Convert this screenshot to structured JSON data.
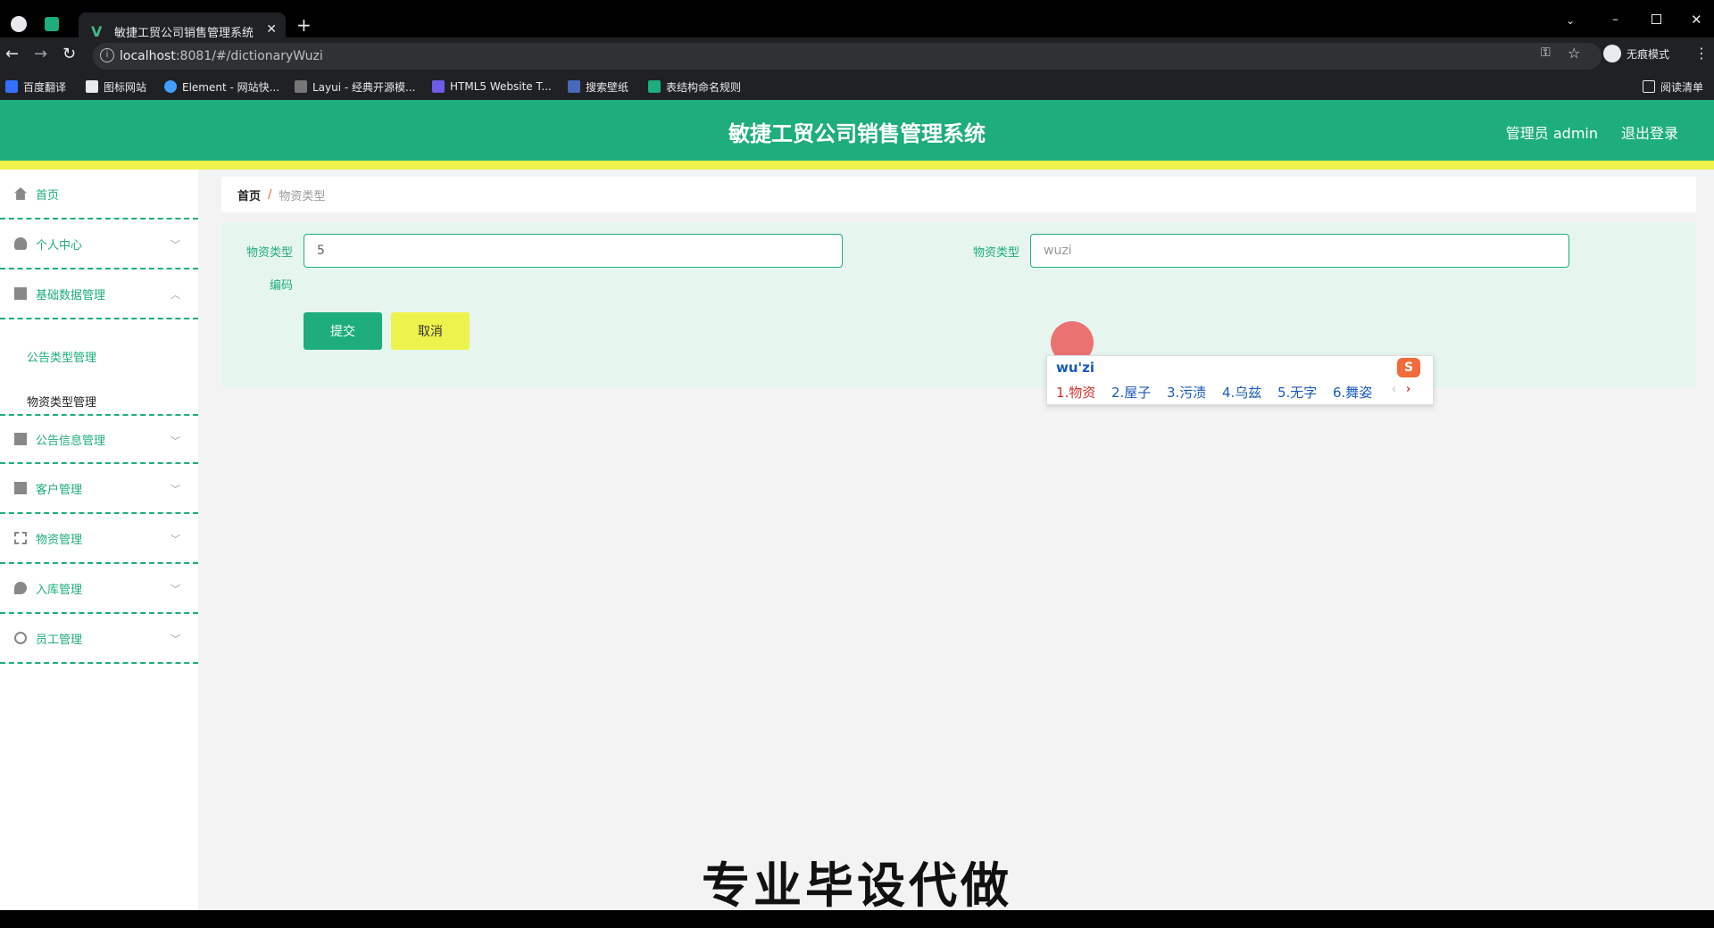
{
  "browser": {
    "tab_title": "敏捷工贸公司销售管理系统",
    "url_host": "localhost",
    "url_rest": ":8081/#/dictionaryWuzi",
    "incognito_label": "无痕模式",
    "bookmarks": [
      "百度翻译",
      "图标网站",
      "Element - 网站快...",
      "Layui - 经典开源模...",
      "HTML5 Website T...",
      "搜索壁纸",
      "表结构命名规则"
    ],
    "reading_list": "阅读清单"
  },
  "header": {
    "title": "敏捷工贸公司销售管理系统",
    "user": "管理员 admin",
    "logout": "退出登录"
  },
  "sidebar": {
    "items": [
      {
        "label": "首页",
        "icon": "home-icon"
      },
      {
        "label": "个人中心",
        "icon": "user-icon"
      },
      {
        "label": "基础数据管理",
        "icon": "database-icon"
      },
      {
        "label": "公告信息管理",
        "icon": "notice-icon"
      },
      {
        "label": "客户管理",
        "icon": "customer-icon"
      },
      {
        "label": "物资管理",
        "icon": "goods-icon"
      },
      {
        "label": "入库管理",
        "icon": "storage-icon"
      },
      {
        "label": "员工管理",
        "icon": "staff-icon"
      }
    ],
    "sub_items": [
      "公告类型管理",
      "物资类型管理"
    ]
  },
  "breadcrumb": {
    "home": "首页",
    "separator": "/",
    "current": "物资类型"
  },
  "form": {
    "code_label_1": "物资类型",
    "code_label_2": "编码",
    "code_value": "5",
    "name_label": "物资类型",
    "name_value": "wuzi",
    "submit": "提交",
    "cancel": "取消"
  },
  "ime": {
    "composition": "wu'zi",
    "candidates": [
      "1.物资",
      "2.屋子",
      "3.污渍",
      "4.乌兹",
      "5.无字",
      "6.舞姿"
    ]
  },
  "overlay_text": "专业毕设代做",
  "colors": {
    "primary": "#1ead7d",
    "accent_yellow": "#eef24c"
  }
}
